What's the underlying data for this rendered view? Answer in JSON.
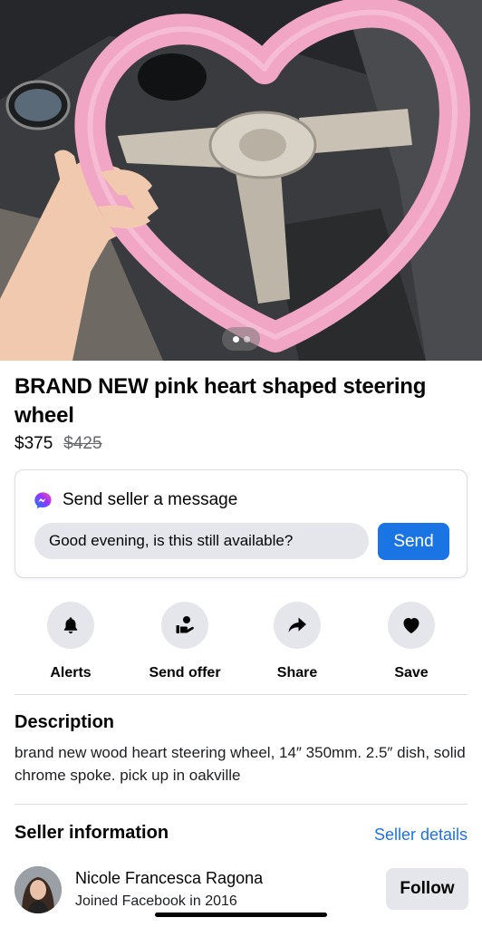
{
  "listing": {
    "title": "BRAND NEW pink heart shaped steering wheel",
    "price": "$375",
    "original_price": "$425",
    "photo_pager": {
      "count": 2,
      "active_index": 0
    }
  },
  "message": {
    "heading": "Send seller a message",
    "input_value": "Good evening, is this still available?",
    "send_label": "Send"
  },
  "actions": [
    {
      "label": "Alerts",
      "icon": "bell-icon"
    },
    {
      "label": "Send offer",
      "icon": "send-offer-icon"
    },
    {
      "label": "Share",
      "icon": "share-arrow-icon"
    },
    {
      "label": "Save",
      "icon": "heart-icon"
    }
  ],
  "description": {
    "heading": "Description",
    "text": "brand new wood heart steering wheel, 14″ 350mm. 2.5″ dish, solid chrome spoke. pick up in oakville"
  },
  "seller": {
    "heading": "Seller information",
    "details_link": "Seller details",
    "name": "Nicole Francesca Ragona",
    "joined": "Joined Facebook in 2016",
    "follow_label": "Follow"
  },
  "colors": {
    "accent": "#1b74e4",
    "button_gray": "#e4e6eb",
    "divider": "#dadde1",
    "wheel_pink": "#f0a6c4"
  }
}
